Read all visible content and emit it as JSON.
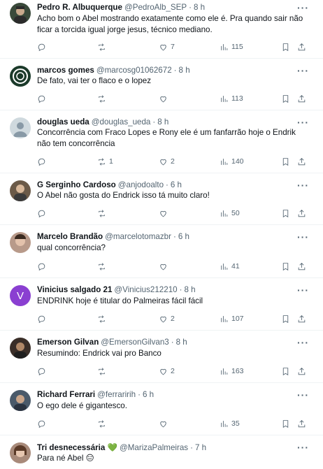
{
  "tweets": [
    {
      "name": "Pedro R. Albuquerque",
      "handle": "@PedroAlb_SEP",
      "time": "8 h",
      "text": "Acho bom o Abel mostrando exatamente como ele é. Pra quando sair não ficar a torcida igual jorge jesus, técnico mediano.",
      "replies": "",
      "retweets": "",
      "likes": "7",
      "views": "115",
      "avatar_color": "#3a4a3a",
      "avatar_icon": "person-photo-icon"
    },
    {
      "name": "marcos gomes",
      "handle": "@marcosg01062672",
      "time": "8 h",
      "text": "De fato, vai ter o flaco e o lopez",
      "replies": "",
      "retweets": "",
      "likes": "",
      "views": "113",
      "avatar_color": "#1b3a2a",
      "avatar_icon": "club-crest-icon"
    },
    {
      "name": "douglas ueda",
      "handle": "@douglas_ueda",
      "time": "8 h",
      "text": "Concorrência com Fraco Lopes e Rony ele é um fanfarrão hoje o Endrik não tem concorrência",
      "replies": "",
      "retweets": "1",
      "likes": "2",
      "views": "140",
      "avatar_color": "#cfd9de",
      "avatar_icon": "default-avatar-icon"
    },
    {
      "name": "G Serginho Cardoso",
      "handle": "@anjodoalto",
      "time": "6 h",
      "text": "O Abel não gosta do Endrick isso tá muito claro!",
      "replies": "",
      "retweets": "",
      "likes": "",
      "views": "50",
      "avatar_color": "#6b5a48",
      "avatar_icon": "person-photo-icon"
    },
    {
      "name": "Marcelo Brandão",
      "handle": "@marcelotomazbr",
      "time": "6 h",
      "text": "qual concorrência?",
      "replies": "",
      "retweets": "",
      "likes": "",
      "views": "41",
      "avatar_color": "#b89a8a",
      "avatar_icon": "person-photo-icon"
    },
    {
      "name": "Vinicius salgado 21",
      "handle": "@Vinicius212210",
      "time": "8 h",
      "text": "ENDRINK hoje é titular do Palmeiras fácil fácil",
      "replies": "",
      "retweets": "",
      "likes": "2",
      "views": "107",
      "avatar_color": "#8a3fd1",
      "avatar_icon": "letter-avatar-icon",
      "avatar_letter": "V"
    },
    {
      "name": "Emerson Gilvan",
      "handle": "@EmersonGilvan3",
      "time": "8 h",
      "text": "Resumindo: Endrick vai pro Banco",
      "replies": "",
      "retweets": "",
      "likes": "2",
      "views": "163",
      "avatar_color": "#3a2e28",
      "avatar_icon": "person-photo-icon"
    },
    {
      "name": "Richard Ferrari",
      "handle": "@ferraririh",
      "time": "6 h",
      "text": "O ego dele é gigantesco.",
      "replies": "",
      "retweets": "",
      "likes": "",
      "views": "35",
      "avatar_color": "#4a5a6a",
      "avatar_icon": "person-photo-icon"
    },
    {
      "name": "Tri desnecessária 💚",
      "handle": "@MarizaPalmeiras",
      "time": "7 h",
      "text": "Para né Abel 😑",
      "replies": "",
      "retweets": "",
      "likes": "",
      "views": "",
      "avatar_color": "#a88a7a",
      "avatar_icon": "person-photo-icon"
    }
  ],
  "separator": "·",
  "more_label": "···"
}
